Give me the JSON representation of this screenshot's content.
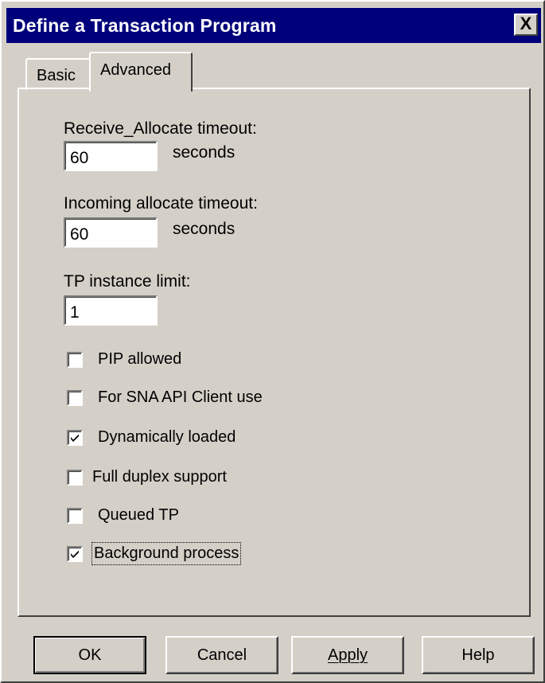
{
  "window": {
    "title": "Define a Transaction Program",
    "close_glyph": "X"
  },
  "tabs": [
    {
      "label": "Basic",
      "selected": false
    },
    {
      "label": "Advanced",
      "selected": true
    }
  ],
  "fields": {
    "receive_allocate": {
      "label": "Receive_Allocate timeout:",
      "value": "60",
      "unit": "seconds"
    },
    "incoming_allocate": {
      "label": "Incoming allocate timeout:",
      "value": "60",
      "unit": "seconds"
    },
    "tp_instance_limit": {
      "label": "TP instance limit:",
      "value": "1"
    }
  },
  "checkboxes": [
    {
      "label": "PIP allowed",
      "checked": false
    },
    {
      "label": "For SNA API Client use",
      "checked": false
    },
    {
      "label": "Dynamically loaded",
      "checked": true
    },
    {
      "label": "Full duplex support",
      "checked": false
    },
    {
      "label": "Queued TP",
      "checked": false
    },
    {
      "label": "Background process",
      "checked": true,
      "focused": true
    }
  ],
  "buttons": {
    "ok": "OK",
    "cancel": "Cancel",
    "apply": "Apply",
    "help": "Help"
  },
  "colors": {
    "titlebar": "#00007b",
    "face": "#d4d0c8"
  }
}
